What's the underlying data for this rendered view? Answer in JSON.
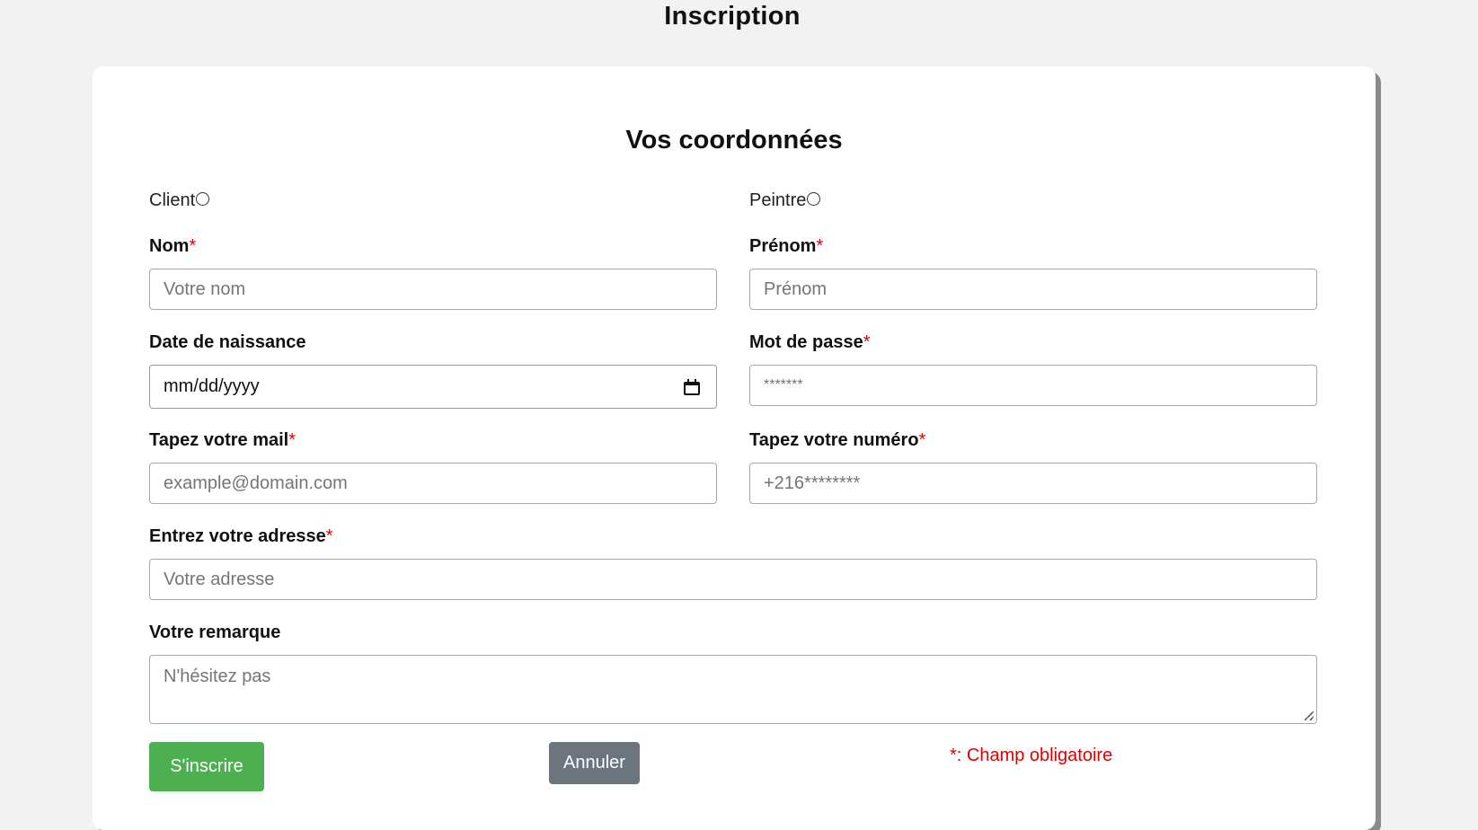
{
  "page": {
    "title": "Inscription"
  },
  "form": {
    "section_title": "Vos coordonnées",
    "roles": [
      {
        "label": "Client",
        "selected": false
      },
      {
        "label": "Peintre",
        "selected": false
      }
    ],
    "required_marker": "*",
    "fields": {
      "nom": {
        "label": "Nom",
        "placeholder": "Votre nom",
        "required": true
      },
      "prenom": {
        "label": "Prénom",
        "placeholder": "Prénom",
        "required": true
      },
      "date_naissance": {
        "label": "Date de naissance",
        "value": "mm/dd/yyyy",
        "required": false
      },
      "mot_de_passe": {
        "label": "Mot de passe",
        "placeholder": "*******",
        "required": true
      },
      "mail": {
        "label": "Tapez votre mail",
        "placeholder": "example@domain.com",
        "required": true
      },
      "numero": {
        "label": "Tapez votre numéro",
        "placeholder": "+216********",
        "required": true
      },
      "adresse": {
        "label": "Entrez votre adresse",
        "placeholder": "Votre adresse",
        "required": true
      },
      "remarque": {
        "label": "Votre remarque",
        "placeholder": "N'hésitez pas",
        "required": false
      }
    },
    "buttons": {
      "submit": "S'inscrire",
      "cancel": "Annuler"
    },
    "required_note": "*: Champ obligatoire"
  },
  "colors": {
    "background": "#f2f2f2",
    "card": "#ffffff",
    "required": "#e00000",
    "submit": "#4caf50",
    "cancel": "#6c757d"
  },
  "icons": {
    "date_picker": "calendar-icon",
    "textarea_resize": "resize-grip-icon"
  }
}
